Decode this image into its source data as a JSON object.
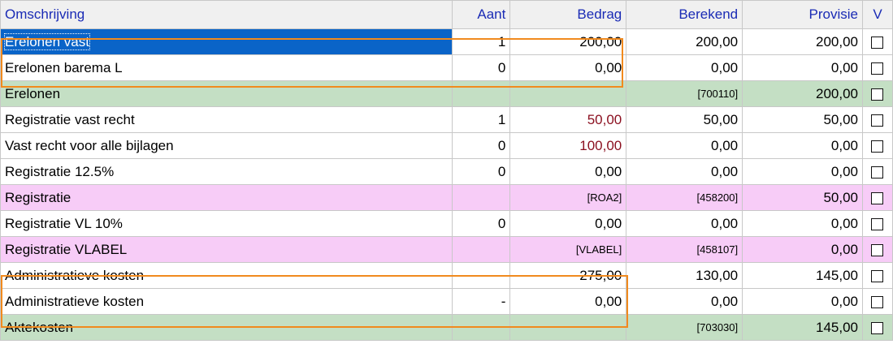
{
  "columns": {
    "description": "Omschrijving",
    "count": "Aant",
    "amount": "Bedrag",
    "calculated": "Berekend",
    "commission": "Provisie",
    "v": "V"
  },
  "rows": [
    {
      "desc": "Erelonen vast",
      "count": "1",
      "amount": "200,00",
      "calc": "200,00",
      "commission": "200,00",
      "checked": false,
      "kind": "item"
    },
    {
      "desc": "Erelonen barema L",
      "count": "0",
      "amount": "0,00",
      "calc": "0,00",
      "commission": "0,00",
      "checked": false,
      "kind": "item"
    },
    {
      "desc": "Erelonen",
      "count": "",
      "amount": "",
      "calc": "[700110]",
      "commission": "200,00",
      "checked": false,
      "kind": "group-green"
    },
    {
      "desc": "Registratie vast recht",
      "count": "1",
      "amount": "50,00",
      "calc": "50,00",
      "commission": "50,00",
      "checked": false,
      "kind": "item"
    },
    {
      "desc": "Vast recht voor alle bijlagen",
      "count": "0",
      "amount": "100,00",
      "calc": "0,00",
      "commission": "0,00",
      "checked": false,
      "kind": "item"
    },
    {
      "desc": "Registratie 12.5%",
      "count": "0",
      "amount": "0,00",
      "calc": "0,00",
      "commission": "0,00",
      "checked": false,
      "kind": "item"
    },
    {
      "desc": "Registratie",
      "count": "",
      "amount": "[ROA2]",
      "calc": "[458200]",
      "commission": "50,00",
      "checked": false,
      "kind": "group-pink"
    },
    {
      "desc": "Registratie VL 10%",
      "count": "0",
      "amount": "0,00",
      "calc": "0,00",
      "commission": "0,00",
      "checked": false,
      "kind": "item"
    },
    {
      "desc": "Registratie VLABEL",
      "count": "",
      "amount": "[VLABEL]",
      "calc": "[458107]",
      "commission": "0,00",
      "checked": false,
      "kind": "group-pink"
    },
    {
      "desc": "Administratieve kosten",
      "count": "-",
      "amount": "275,00",
      "calc": "130,00",
      "commission": "145,00",
      "checked": false,
      "kind": "item"
    },
    {
      "desc": "Administratieve kosten",
      "count": "-",
      "amount": "0,00",
      "calc": "0,00",
      "commission": "0,00",
      "checked": false,
      "kind": "item"
    },
    {
      "desc": "Aktekosten",
      "count": "",
      "amount": "",
      "calc": "[703030]",
      "commission": "145,00",
      "checked": false,
      "kind": "group-green"
    }
  ],
  "colors": {
    "header_text": "#1a2bb5",
    "selection": "#0a64c8",
    "group_green": "#c4dfc4",
    "group_pink": "#f7ccf7",
    "highlight": "#f18a1e",
    "red_value": "#8b1020"
  }
}
